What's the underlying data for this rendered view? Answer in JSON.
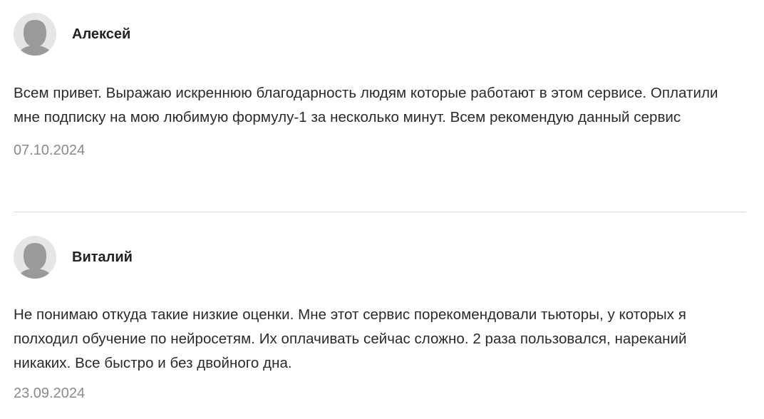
{
  "reviews": [
    {
      "author": "Алексей",
      "avatar_icon": "user-avatar-icon",
      "text": "Всем привет. Выражаю искреннюю благодарность людям которые работают в этом сервисе. Оплатили мне подписку на мою любимую формулу-1 за несколько минут. Всем рекомендую данный сервис",
      "date": "07.10.2024"
    },
    {
      "author": "Виталий",
      "avatar_icon": "user-avatar-icon",
      "text": "Не понимаю откуда такие низкие оценки. Мне этот сервис порекомендовали тьюторы, у которых я полходил обучение по нейросетям. Их оплачивать сейчас сложно. 2 раза пользовался, нареканий никаких. Все быстро и без двойного дна.",
      "date": "23.09.2024"
    }
  ],
  "colors": {
    "avatar_bg": "#e6e6e6",
    "avatar_figure": "#9a9a9a",
    "date": "#8a8a8a",
    "divider": "#dcdcdc"
  }
}
